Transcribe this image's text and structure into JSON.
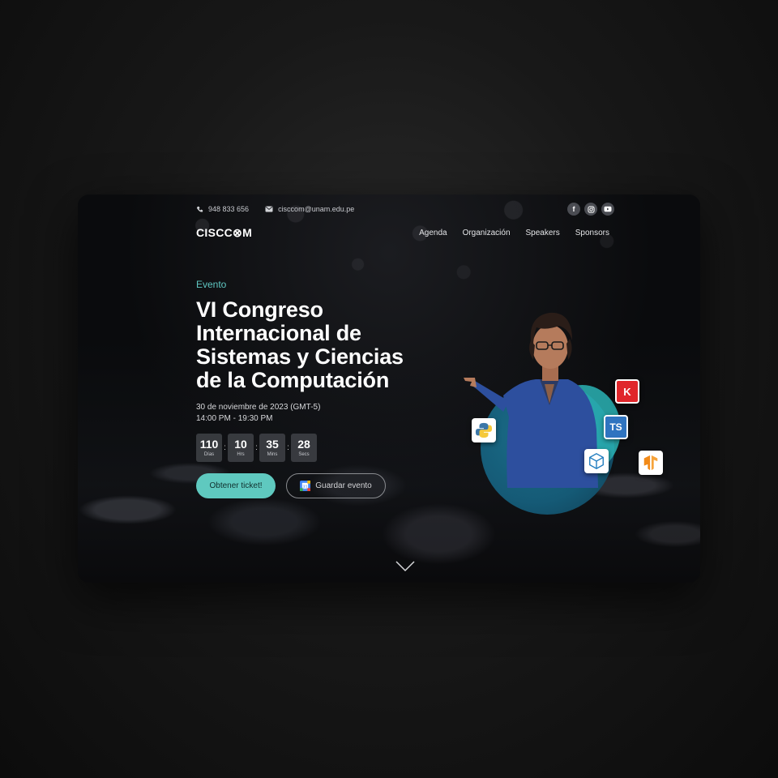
{
  "topbar": {
    "phone": "948 833 656",
    "email": "cisccom@unam.edu.pe",
    "socials": [
      "facebook-icon",
      "instagram-icon",
      "youtube-icon"
    ]
  },
  "nav": {
    "logo": "CISCC⊗M",
    "items": [
      "Agenda",
      "Organización",
      "Speakers",
      "Sponsors"
    ]
  },
  "hero": {
    "eyebrow": "Evento",
    "title_lines": [
      "VI Congreso",
      "Internacional de",
      "Sistemas y Ciencias",
      "de la Computación"
    ],
    "date_line": "30 de noviembre de 2023 (GMT-5)",
    "time_line": "14:00 PM - 19:30 PM",
    "countdown": [
      {
        "value": "110",
        "label": "Días"
      },
      {
        "value": "10",
        "label": "Hrs"
      },
      {
        "value": "35",
        "label": "Mins"
      },
      {
        "value": "28",
        "label": "Secs"
      }
    ],
    "primary_button": "Obtener ticket!",
    "secondary_button": "Guardar evento"
  },
  "tech_chips": [
    "python-icon",
    "k-icon",
    "typescript-icon",
    "threejs-icon",
    "tensorflow-icon"
  ],
  "chip_labels": {
    "k": "K",
    "ts": "TS"
  },
  "colors": {
    "accent": "#5fc9bf",
    "eyebrow": "#5fc7c2",
    "circle": "#155a76",
    "circle_ring": "#2ab3b5"
  }
}
